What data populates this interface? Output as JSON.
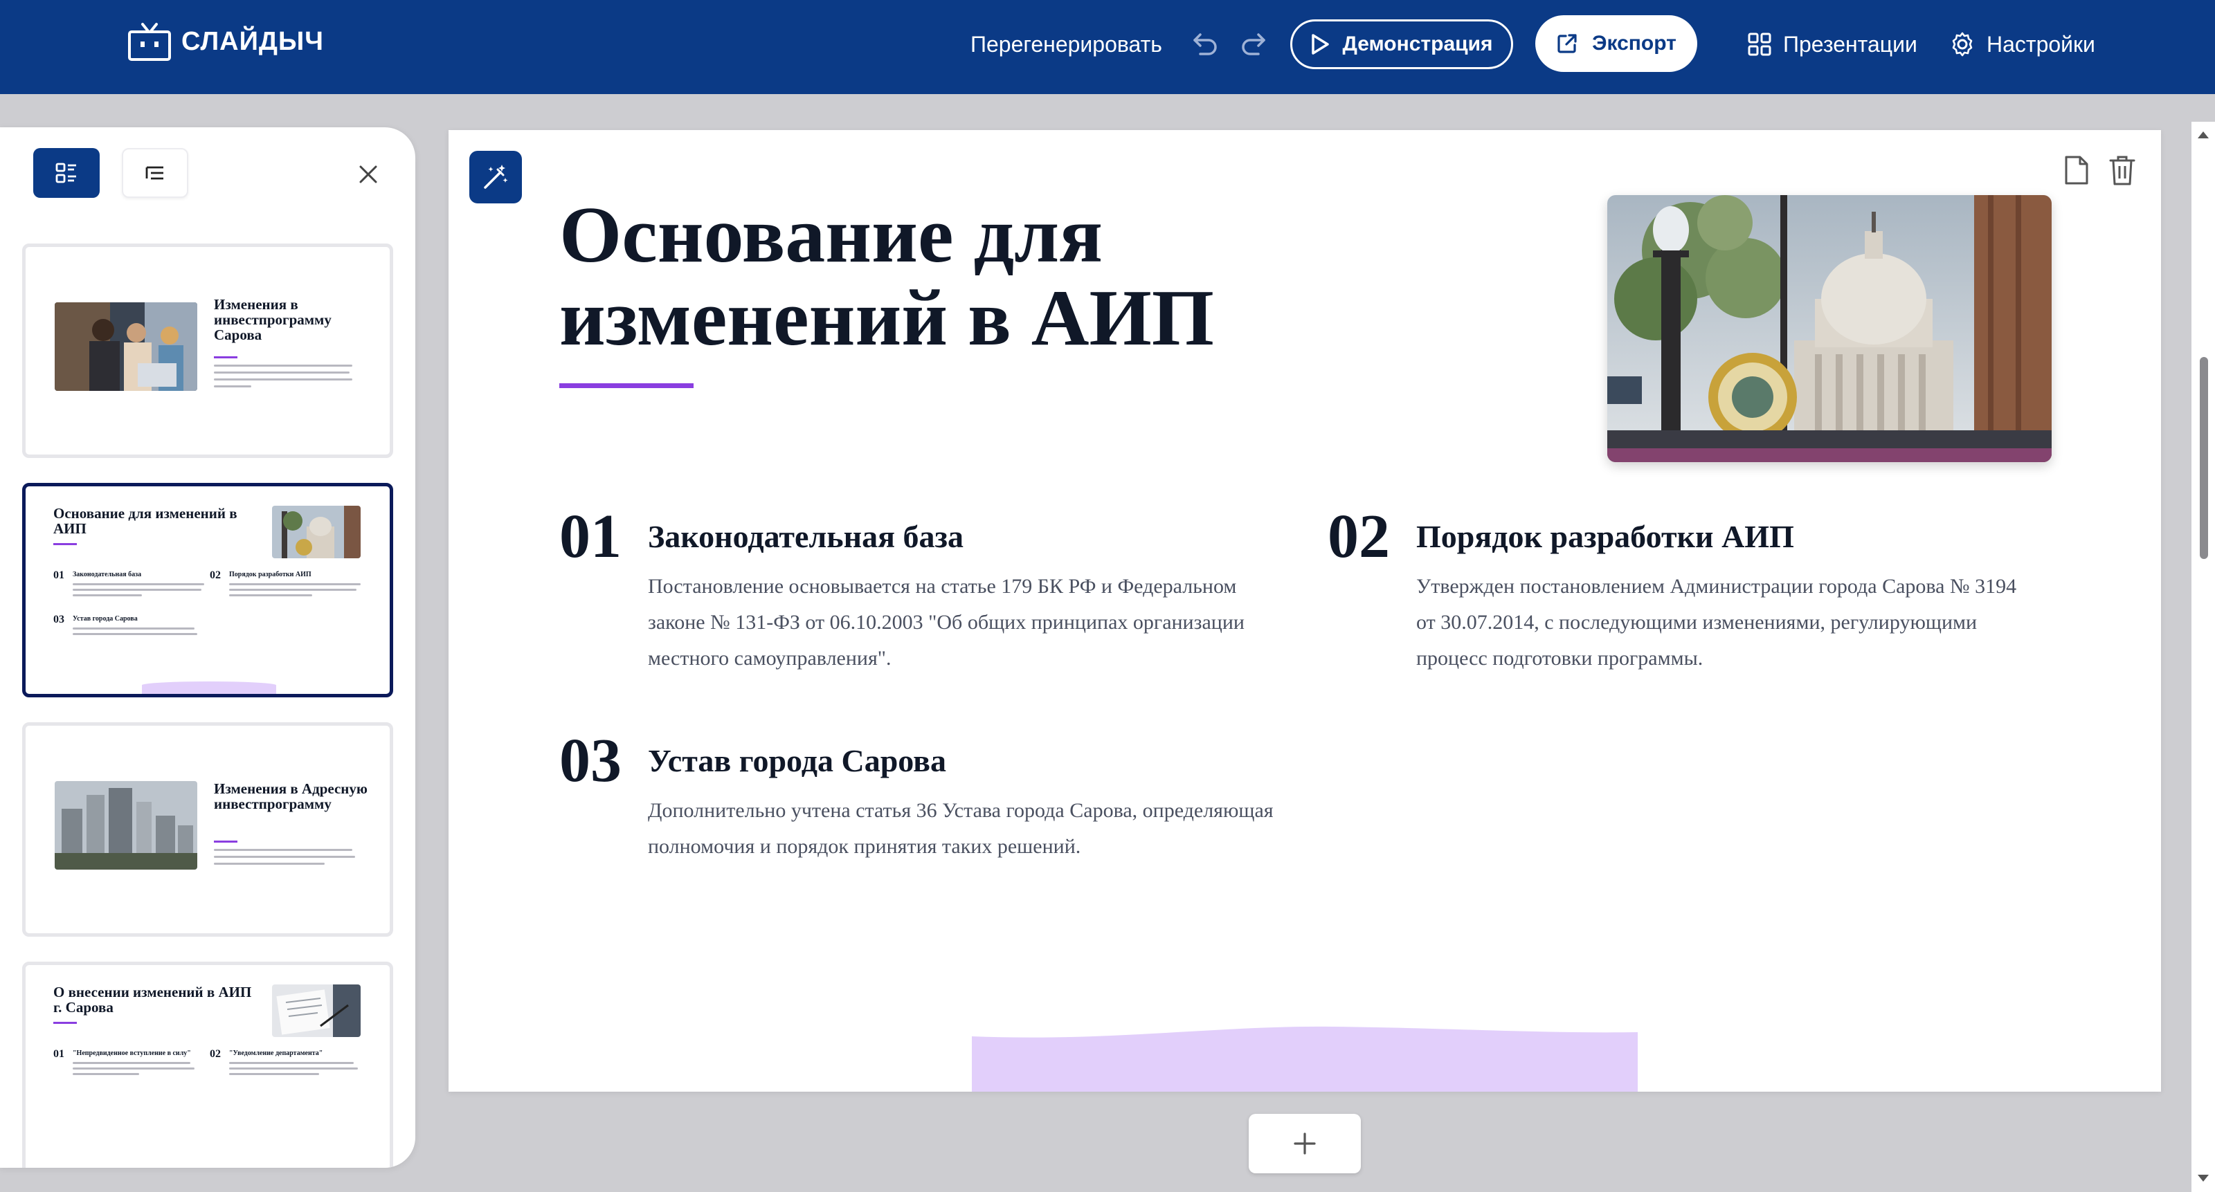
{
  "app": {
    "logo_text": "СЛАЙДЫЧ"
  },
  "header": {
    "regenerate_label": "Перегенерировать",
    "demo_label": "Демонстрация",
    "export_label": "Экспорт",
    "presentations_label": "Презентации",
    "settings_label": "Настройки"
  },
  "sidebar": {
    "thumbnails": [
      {
        "title": "Изменения в инвестпрограмму Сарова"
      },
      {
        "title": "Основание для изменений в АИП",
        "items": [
          {
            "num": "01",
            "title": "Законодательная база"
          },
          {
            "num": "02",
            "title": "Порядок разработки АИП"
          },
          {
            "num": "03",
            "title": "Устав города Сарова"
          }
        ]
      },
      {
        "title": "Изменения в Адресную инвестпрограмму"
      },
      {
        "title": "О внесении изменений в АИП г. Сарова",
        "items": [
          {
            "num": "01",
            "title": "\"Непредвиденное вступление в силу\""
          },
          {
            "num": "02",
            "title": "\"Уведомление департамента\""
          }
        ]
      }
    ]
  },
  "slide": {
    "title": "Основание для изменений в АИП",
    "points": [
      {
        "num": "01",
        "title": "Законодательная база",
        "text": "Постановление основывается на статье 179 БК РФ и Федеральном законе № 131-ФЗ от 06.10.2003 \"Об общих принципах организации местного самоуправления\"."
      },
      {
        "num": "02",
        "title": "Порядок разработки АИП",
        "text": "Утвержден постановлением Администрации города Сарова № 3194 от 30.07.2014, с последующими изменениями, регулирующими процесс подготовки программы."
      },
      {
        "num": "03",
        "title": "Устав города Сарова",
        "text": "Дополнительно учтена статья 36 Устава города Сарова, определяющая полномочия и порядок принятия таких решений."
      }
    ]
  },
  "colors": {
    "brand": "#0b3a86",
    "accent": "#8a3ee0",
    "wave": "#e2cffb"
  }
}
